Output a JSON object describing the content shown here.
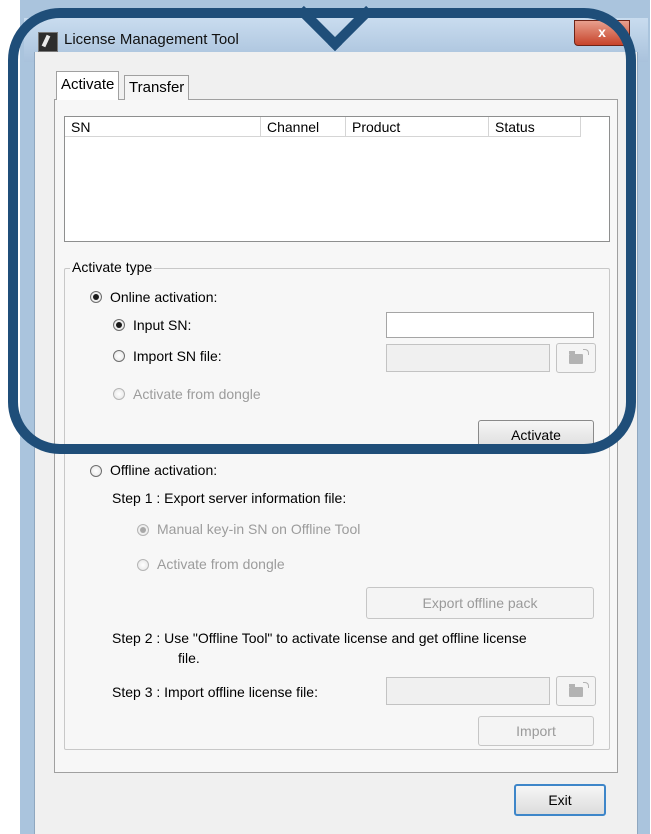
{
  "window": {
    "title": "License Management Tool",
    "close_symbol": "x"
  },
  "tabs": [
    {
      "label": "Activate"
    },
    {
      "label": "Transfer"
    }
  ],
  "table": {
    "columns": [
      "SN",
      "Channel",
      "Product",
      "Status"
    ],
    "rows": []
  },
  "activate_type": {
    "group_label": "Activate type",
    "online": {
      "label": "Online activation:",
      "input_sn_label": "Input SN:",
      "import_sn_label": "Import SN file:",
      "dongle_label": "Activate from dongle",
      "activate_button": "Activate"
    },
    "offline": {
      "label": "Offline activation:",
      "step1": "Step 1 : Export server information file:",
      "manual_label": "Manual key-in SN on Offline Tool",
      "dongle_label": "Activate from dongle",
      "export_button": "Export offline pack",
      "step2_line1": "Step 2 : Use \"Offline Tool\" to activate license and get offline license",
      "step2_line2": "file.",
      "step3": "Step 3 : Import offline license file:",
      "import_button": "Import"
    }
  },
  "exit_button": "Exit",
  "colors": {
    "highlight": "#1f4e79",
    "close": "#c7432a"
  }
}
